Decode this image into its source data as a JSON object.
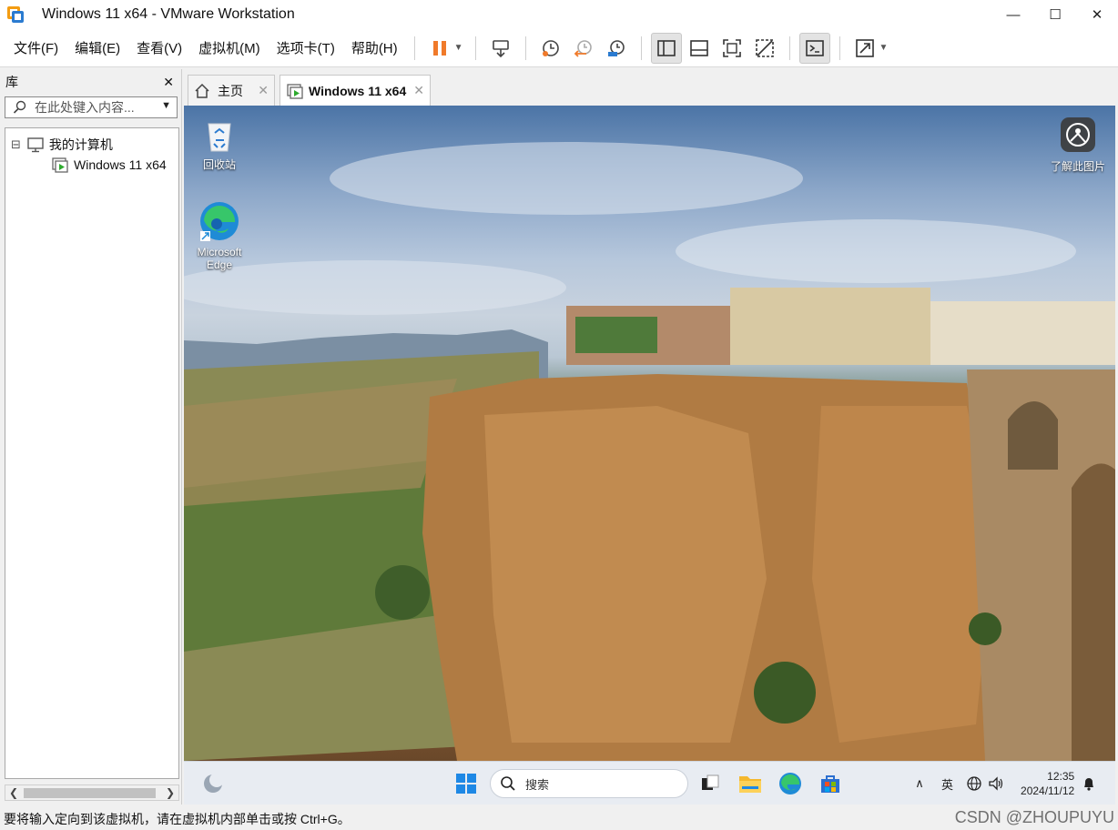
{
  "window": {
    "title": "Windows 11 x64 - VMware Workstation",
    "controls": {
      "minimize": "—",
      "maximize": "☐",
      "close": "✕"
    }
  },
  "menu": {
    "file": "文件(F)",
    "edit": "编辑(E)",
    "view": "查看(V)",
    "vm": "虚拟机(M)",
    "tabs": "选项卡(T)",
    "help": "帮助(H)"
  },
  "library": {
    "title": "库",
    "close_glyph": "✕",
    "search_placeholder": "在此处键入内容...",
    "tree": {
      "expander": "⊟",
      "root_label": "我的计算机",
      "vm_label": "Windows 11 x64"
    },
    "scroll_left": "❮",
    "scroll_right": "❯"
  },
  "tabs": [
    {
      "label": "主页",
      "close": "✕"
    },
    {
      "label": "Windows 11 x64",
      "close": "✕"
    }
  ],
  "desktop": {
    "icons": [
      {
        "label": "回收站"
      },
      {
        "label": "Microsoft Edge"
      }
    ],
    "learn_more": "了解此图片"
  },
  "taskbar": {
    "search_label": "搜索",
    "tray": {
      "chevron": "∧",
      "ime": "英",
      "time": "12:35",
      "date": "2024/11/12"
    }
  },
  "status": {
    "message": "要将输入定向到该虚拟机，请在虚拟机内部单击或按 Ctrl+G。",
    "watermark": "CSDN @ZHOUPUYU"
  },
  "colors": {
    "accent_orange": "#f07a2a",
    "accent_blue": "#2b7bd0",
    "taskbar": "#e8ecf2"
  }
}
